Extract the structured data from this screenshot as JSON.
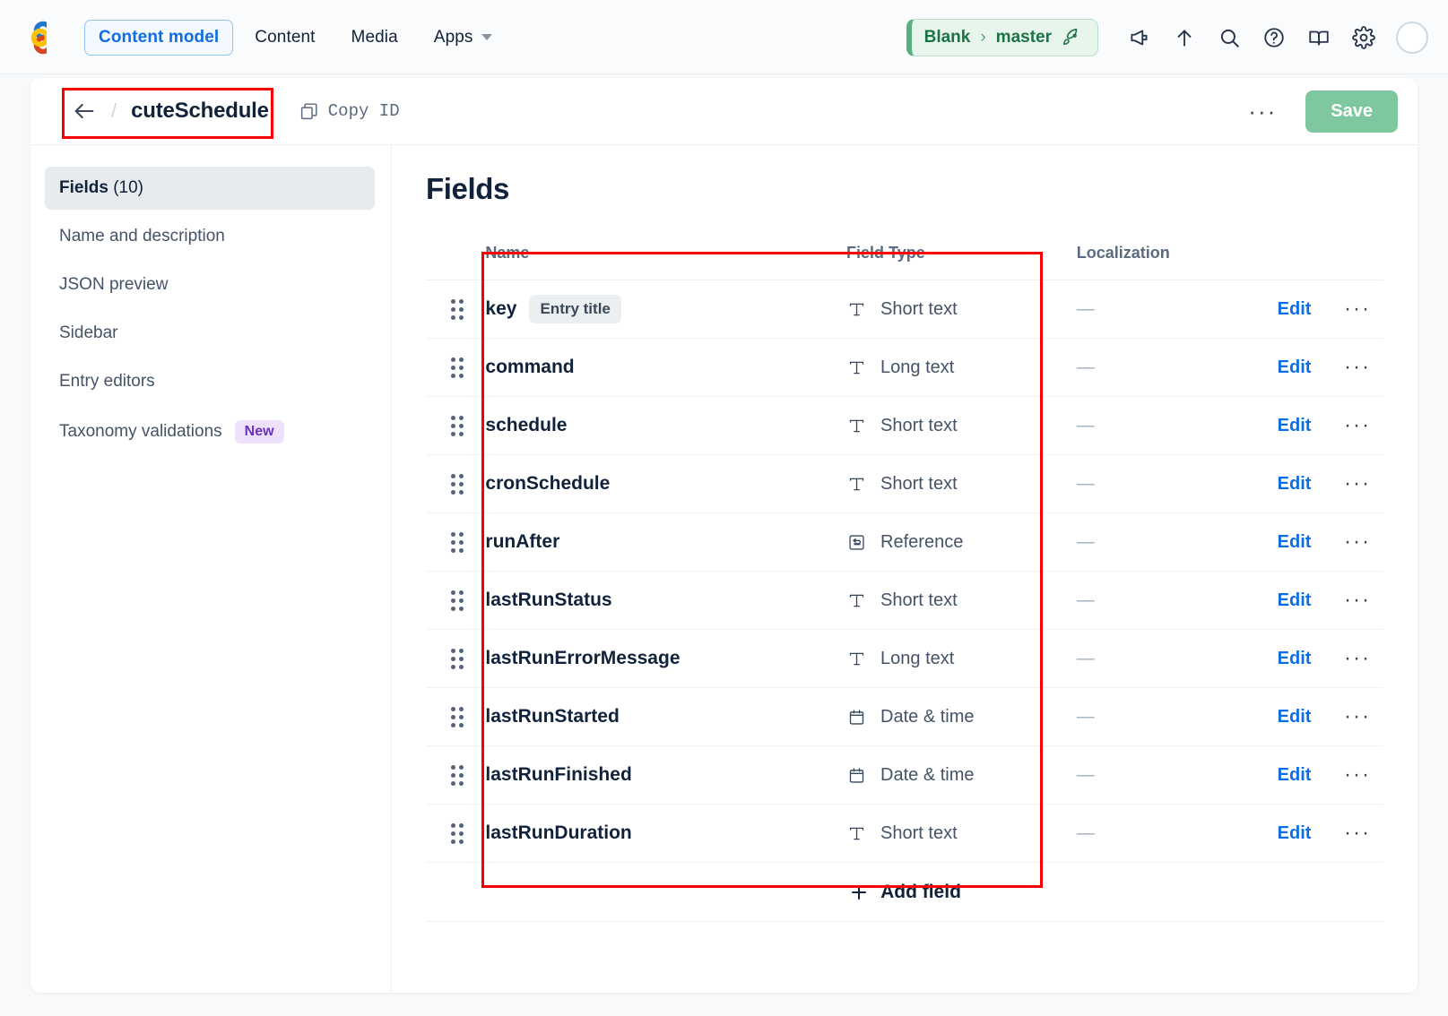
{
  "topnav": {
    "logo_name": "contentful-logo",
    "items": [
      {
        "label": "Content model",
        "active": true
      },
      {
        "label": "Content",
        "active": false
      },
      {
        "label": "Media",
        "active": false
      },
      {
        "label": "Apps",
        "active": false,
        "caret": true
      }
    ],
    "environment": {
      "space": "Blank",
      "separator": "›",
      "env": "master",
      "icon": "rocket-icon"
    },
    "icons": [
      "megaphone-icon",
      "arrow-up-icon",
      "search-icon",
      "help-circle-icon",
      "book-icon",
      "gear-icon"
    ],
    "avatar": "user-avatar"
  },
  "header": {
    "back": "←",
    "slash": "/",
    "title": "cuteSchedule",
    "copy_id_label": "Copy ID",
    "copy_icon": "copy-icon",
    "more_label": "···",
    "save_label": "Save"
  },
  "sidebar": {
    "items": [
      {
        "label": "Fields",
        "count": "(10)",
        "active": true
      },
      {
        "label": "Name and description",
        "active": false
      },
      {
        "label": "JSON preview",
        "active": false
      },
      {
        "label": "Sidebar",
        "active": false
      },
      {
        "label": "Entry editors",
        "active": false
      },
      {
        "label": "Taxonomy validations",
        "active": false,
        "badge": "New"
      }
    ]
  },
  "main": {
    "title": "Fields",
    "columns": {
      "name": "Name",
      "type": "Field Type",
      "localization": "Localization"
    },
    "row_actions": {
      "edit": "Edit",
      "menu": "···"
    },
    "localization_empty": "—",
    "add_field_label": "Add field",
    "add_field_icon": "plus-icon",
    "fields": [
      {
        "name": "key",
        "badge": "Entry title",
        "type": "Short text",
        "type_icon": "text-icon",
        "localization": "—"
      },
      {
        "name": "command",
        "badge": "",
        "type": "Long text",
        "type_icon": "text-icon",
        "localization": "—"
      },
      {
        "name": "schedule",
        "badge": "",
        "type": "Short text",
        "type_icon": "text-icon",
        "localization": "—"
      },
      {
        "name": "cronSchedule",
        "badge": "",
        "type": "Short text",
        "type_icon": "text-icon",
        "localization": "—"
      },
      {
        "name": "runAfter",
        "badge": "",
        "type": "Reference",
        "type_icon": "reference-icon",
        "localization": "—"
      },
      {
        "name": "lastRunStatus",
        "badge": "",
        "type": "Short text",
        "type_icon": "text-icon",
        "localization": "—"
      },
      {
        "name": "lastRunErrorMessage",
        "badge": "",
        "type": "Long text",
        "type_icon": "text-icon",
        "localization": "—"
      },
      {
        "name": "lastRunStarted",
        "badge": "",
        "type": "Date & time",
        "type_icon": "calendar-icon",
        "localization": "—"
      },
      {
        "name": "lastRunFinished",
        "badge": "",
        "type": "Date & time",
        "type_icon": "calendar-icon",
        "localization": "—"
      },
      {
        "name": "lastRunDuration",
        "badge": "",
        "type": "Short text",
        "type_icon": "text-icon",
        "localization": "—"
      }
    ]
  },
  "annotations": {
    "color": "#f80000",
    "boxes": [
      "breadcrumb-highlight",
      "fields-table-highlight"
    ]
  }
}
